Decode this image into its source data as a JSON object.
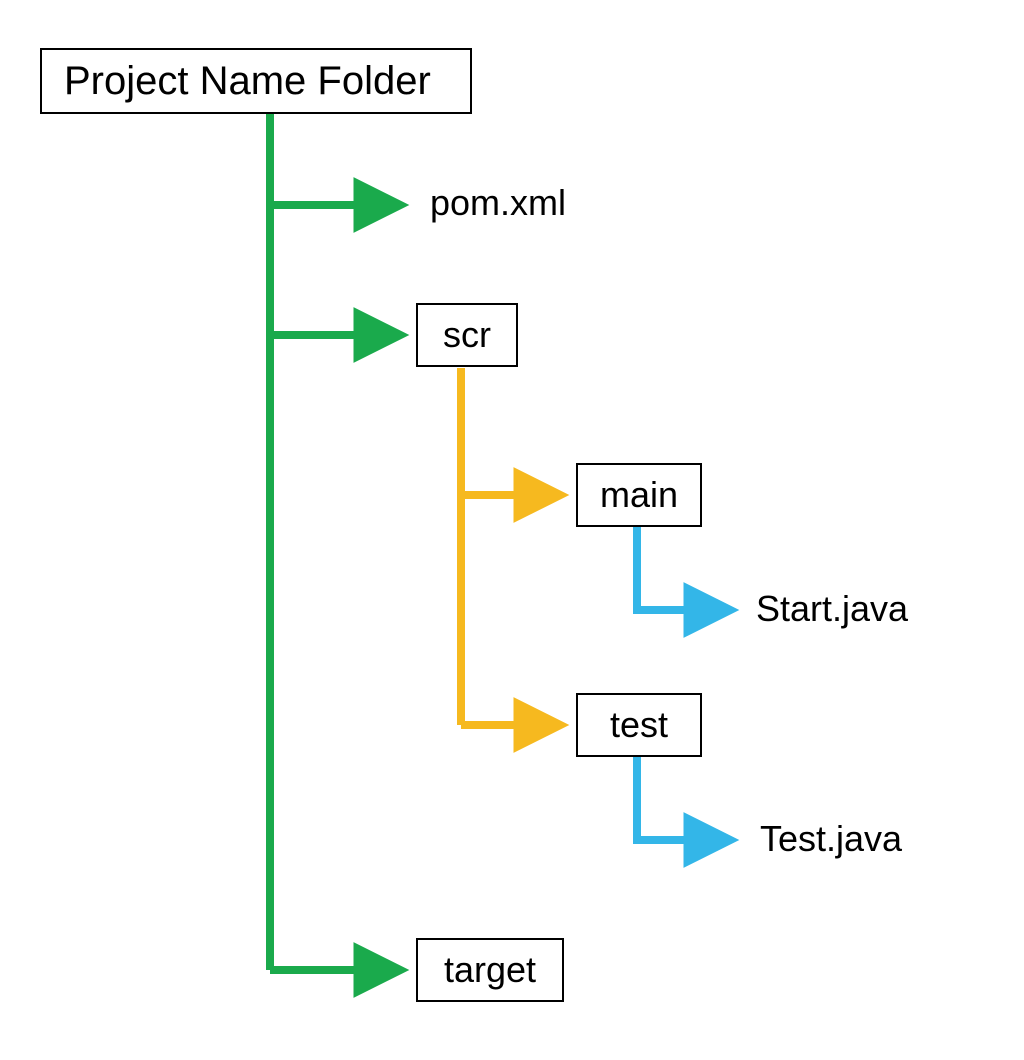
{
  "diagram": {
    "root": {
      "label": "Project Name Folder"
    },
    "nodes": {
      "pom": {
        "label": "pom.xml"
      },
      "scr": {
        "label": "scr"
      },
      "main": {
        "label": "main"
      },
      "start": {
        "label": "Start.java"
      },
      "test": {
        "label": "test"
      },
      "testj": {
        "label": "Test.java"
      },
      "target": {
        "label": "target"
      }
    },
    "colors": {
      "green": "#1aaa4c",
      "orange": "#f6b91f",
      "blue": "#33b6e8"
    }
  }
}
